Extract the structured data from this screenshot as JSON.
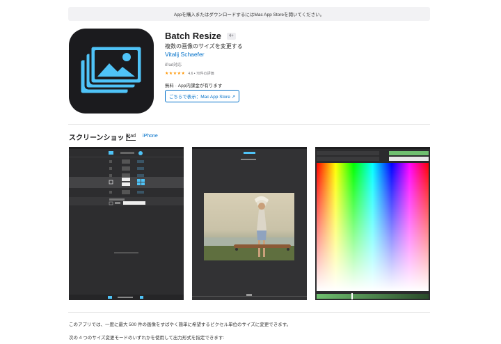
{
  "banner": {
    "text": "Appを購入またはダウンロードするにはMac App Storeを開いてください。"
  },
  "app": {
    "name": "Batch Resize",
    "age_rating": "4+",
    "subtitle": "複数の画像のサイズを変更する",
    "developer": "Vitalij Schaefer",
    "device_compat": "iPad対応",
    "rating_stars": "★★★★★",
    "rating_text": "4.6 • 70件の評価",
    "price_text": "無料 · App内課金が有ります",
    "store_button": "ごちらで表示：Mac App Store ↗"
  },
  "screenshots": {
    "title": "スクリーンショット",
    "tabs": [
      "iPad",
      "iPhone"
    ],
    "active_tab": "iPad"
  },
  "description": {
    "line1": "このアプリでは、一度に最大 500 件の画像をすばやく簡単に希望するピクセル単位のサイズに変更できます。",
    "line2": "次の 4 つのサイズ変更モードのいずれかを使用して出力形式を指定できます:"
  },
  "colors": {
    "link": "#0070c9",
    "icon_bg": "#1b1b1e",
    "icon_accent": "#4fc3f7",
    "star": "#ff9500"
  }
}
